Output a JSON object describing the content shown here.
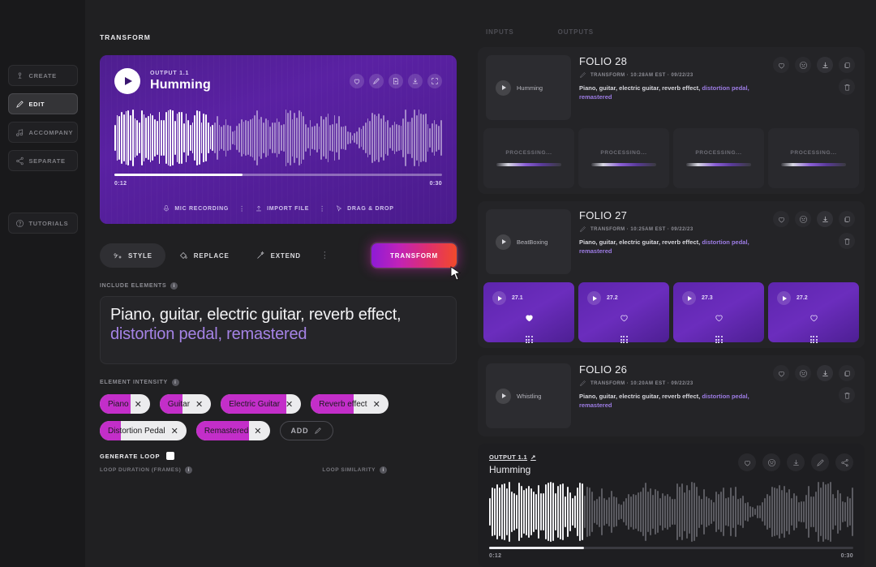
{
  "header": {
    "title": "TRANSFORM",
    "tabs": [
      "INPUTS",
      "OUTPUTS"
    ]
  },
  "sidebar": {
    "items": [
      {
        "label": "CREATE",
        "icon": "create-icon",
        "active": false
      },
      {
        "label": "EDIT",
        "icon": "edit-pencil-icon",
        "active": true
      },
      {
        "label": "ACCOMPANY",
        "icon": "accompany-icon",
        "active": false
      },
      {
        "label": "SEPARATE",
        "icon": "separate-icon",
        "active": false
      }
    ],
    "tutorials": {
      "label": "TUTORIALS",
      "icon": "help-icon"
    }
  },
  "player": {
    "kicker": "OUTPUT 1.1",
    "title": "Humming",
    "time_current": "0:12",
    "time_total": "0:30",
    "progress_pct": 39,
    "icons": [
      "heart-icon",
      "edit-pencil-icon",
      "document-icon",
      "download-icon",
      "expand-icon"
    ],
    "sources": [
      {
        "label": "MIC RECORDING",
        "icon": "microphone-icon"
      },
      {
        "label": "IMPORT FILE",
        "icon": "upload-icon"
      },
      {
        "label": "DRAG & DROP",
        "icon": "cursor-icon"
      }
    ]
  },
  "actions": {
    "items": [
      {
        "label": "STYLE",
        "icon": "style-icon",
        "selected": true
      },
      {
        "label": "REPLACE",
        "icon": "paint-icon",
        "selected": false
      },
      {
        "label": "EXTEND",
        "icon": "wand-icon",
        "selected": false
      }
    ],
    "kebab": "⋮",
    "transform_label": "TRANSFORM"
  },
  "include_elements": {
    "label": "INCLUDE ELEMENTS",
    "info": "i",
    "text_plain": "Piano, guitar, electric guitar, reverb effect, ",
    "text_highlight": "distortion pedal, remastered"
  },
  "element_intensity": {
    "label": "ELEMENT INTENSITY",
    "info": "i",
    "chips": [
      {
        "label": "Piano",
        "fill_pct": 62
      },
      {
        "label": "Guitar",
        "fill_pct": 45
      },
      {
        "label": "Electric Guitar",
        "fill_pct": 82
      },
      {
        "label": "Reverb effect",
        "fill_pct": 55
      },
      {
        "label": "Distortion Pedal",
        "fill_pct": 24
      },
      {
        "label": "Remastered",
        "fill_pct": 72
      }
    ],
    "add_label": "ADD"
  },
  "loop": {
    "generate_label": "GENERATE LOOP",
    "checked": true,
    "duration_label": "LOOP DURATION (FRAMES)",
    "similarity_label": "LOOP SIMILARITY",
    "info": "i"
  },
  "folios": [
    {
      "title": "FOLIO 28",
      "thumb_label": "Humming",
      "meta": "TRANSFORM · 10:28AM EST · 09/22/23",
      "desc_plain": "Piano, guitar, electric guitar, reverb effect, ",
      "desc_highlight": "distortion pedal, remastered",
      "icons": [
        "heart-icon",
        "sad-face-icon",
        "download-icon",
        "copy-icon",
        "trash-icon"
      ],
      "tiles": [
        {
          "type": "processing",
          "label": "PROCESSING..."
        },
        {
          "type": "processing",
          "label": "PROCESSING..."
        },
        {
          "type": "processing",
          "label": "PROCESSING..."
        },
        {
          "type": "processing",
          "label": "PROCESSING..."
        }
      ]
    },
    {
      "title": "FOLIO 27",
      "thumb_label": "BeatBoxing",
      "meta": "TRANSFORM · 10:25AM EST · 09/22/23",
      "desc_plain": "Piano, guitar, electric guitar, reverb effect, ",
      "desc_highlight": "distortion pedal, remastered",
      "icons": [
        "heart-icon",
        "sad-face-icon",
        "download-icon",
        "copy-icon",
        "trash-icon"
      ],
      "tiles": [
        {
          "type": "version",
          "label": "27.1",
          "liked": true
        },
        {
          "type": "version",
          "label": "27.2",
          "liked": false
        },
        {
          "type": "version",
          "label": "27.3",
          "liked": false
        },
        {
          "type": "version",
          "label": "27.2",
          "liked": false
        }
      ]
    },
    {
      "title": "FOLIO 26",
      "thumb_label": "Whistling",
      "meta": "TRANSFORM · 10:20AM EST · 09/22/23",
      "desc_plain": "Piano, guitar, electric guitar, reverb effect, ",
      "desc_highlight": "distortion pedal, remastered",
      "icons": [
        "heart-icon",
        "sad-face-icon",
        "download-icon",
        "copy-icon",
        "trash-icon"
      ],
      "tiles": []
    }
  ],
  "bottom_player": {
    "kicker": "OUTPUT 1.1",
    "title": "Humming",
    "time_current": "0:12",
    "time_total": "0:30",
    "progress_pct": 26,
    "icons": [
      "heart-icon",
      "sad-face-icon",
      "download-icon",
      "edit-pencil-icon",
      "share-icon"
    ]
  },
  "colors": {
    "player_purple": "#5a21a3",
    "accent_highlight": "#a583e6",
    "chip_fill": "#c32ec9",
    "transform_gradient_start": "#8d1bd6",
    "transform_gradient_end": "#f24a2a",
    "panel_bg": "#242427",
    "app_bg": "#202022"
  }
}
